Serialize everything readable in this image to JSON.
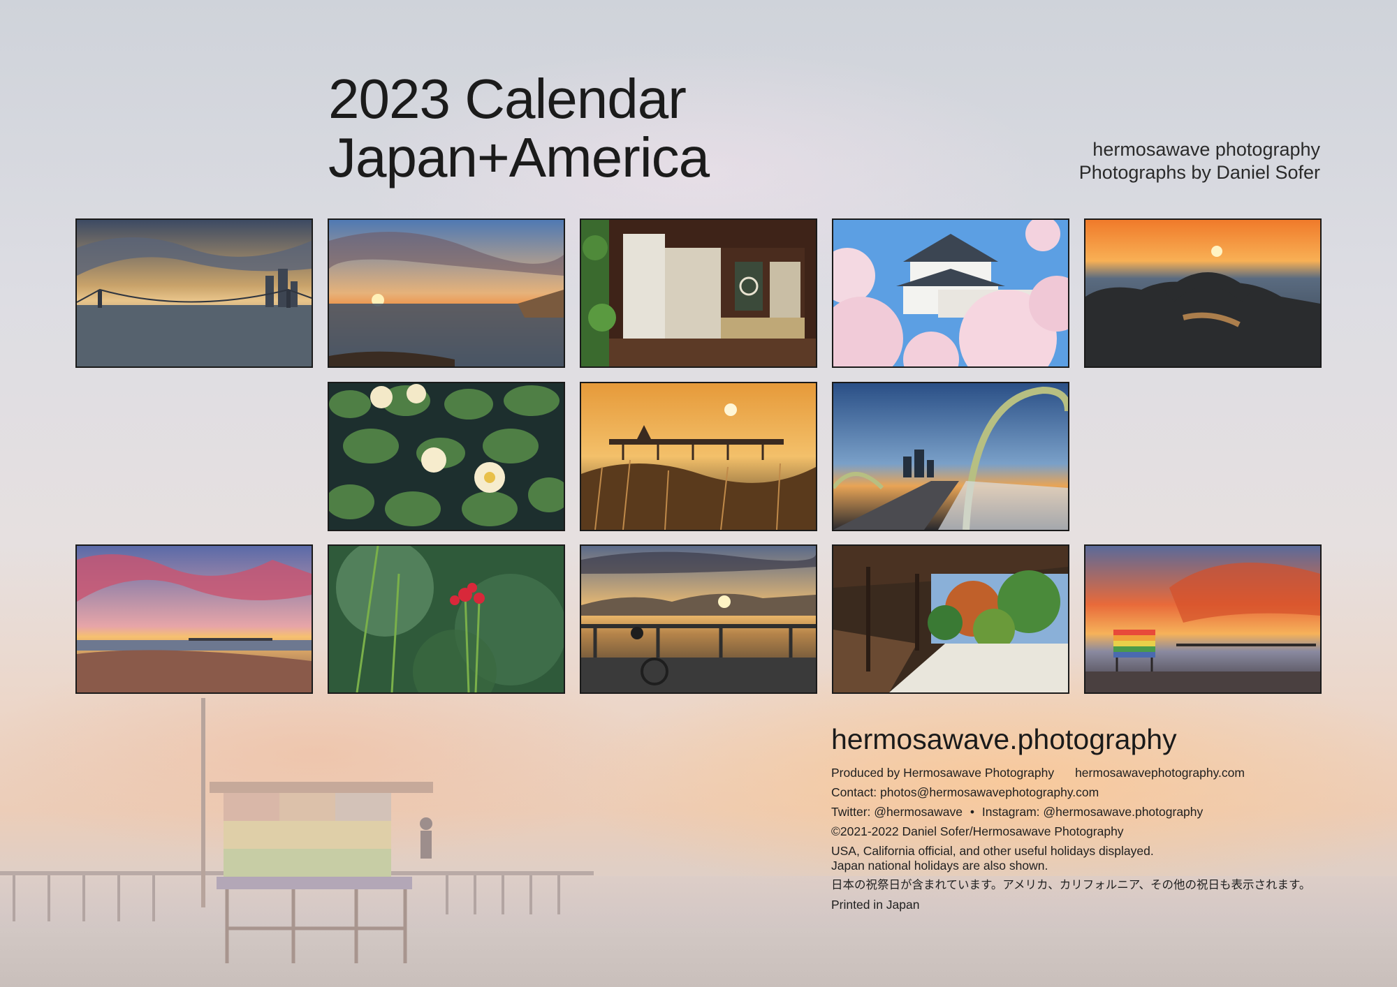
{
  "header": {
    "title_line1": "2023 Calendar",
    "title_line2": "Japan+America",
    "brand_line1": "hermosawave photography",
    "brand_line2": "Photographs by Daniel Sofer"
  },
  "footer": {
    "site": "hermosawave.photography",
    "produced_by": "Produced by Hermosawave Photography",
    "website": "hermosawavephotography.com",
    "contact": "Contact: photos@hermosawavephotography.com",
    "twitter": "Twitter: @hermosawave",
    "separator": "•",
    "instagram": "Instagram: @hermosawave.photography",
    "copyright": "©2021-2022 Daniel Sofer/Hermosawave Photography",
    "holidays_line1": "USA, California official, and other useful holidays displayed.",
    "holidays_line2": "Japan national holidays are also shown.",
    "japanese_note": "日本の祝祭日が含まれています。アメリカ、カリフォルニア、その他の祝日も表示されます。",
    "printed": "Printed in Japan"
  },
  "colors": {
    "frame": "#1a1a1a",
    "sunset_orange": "#f2a04a",
    "sky_blue": "#5b8fd0"
  }
}
